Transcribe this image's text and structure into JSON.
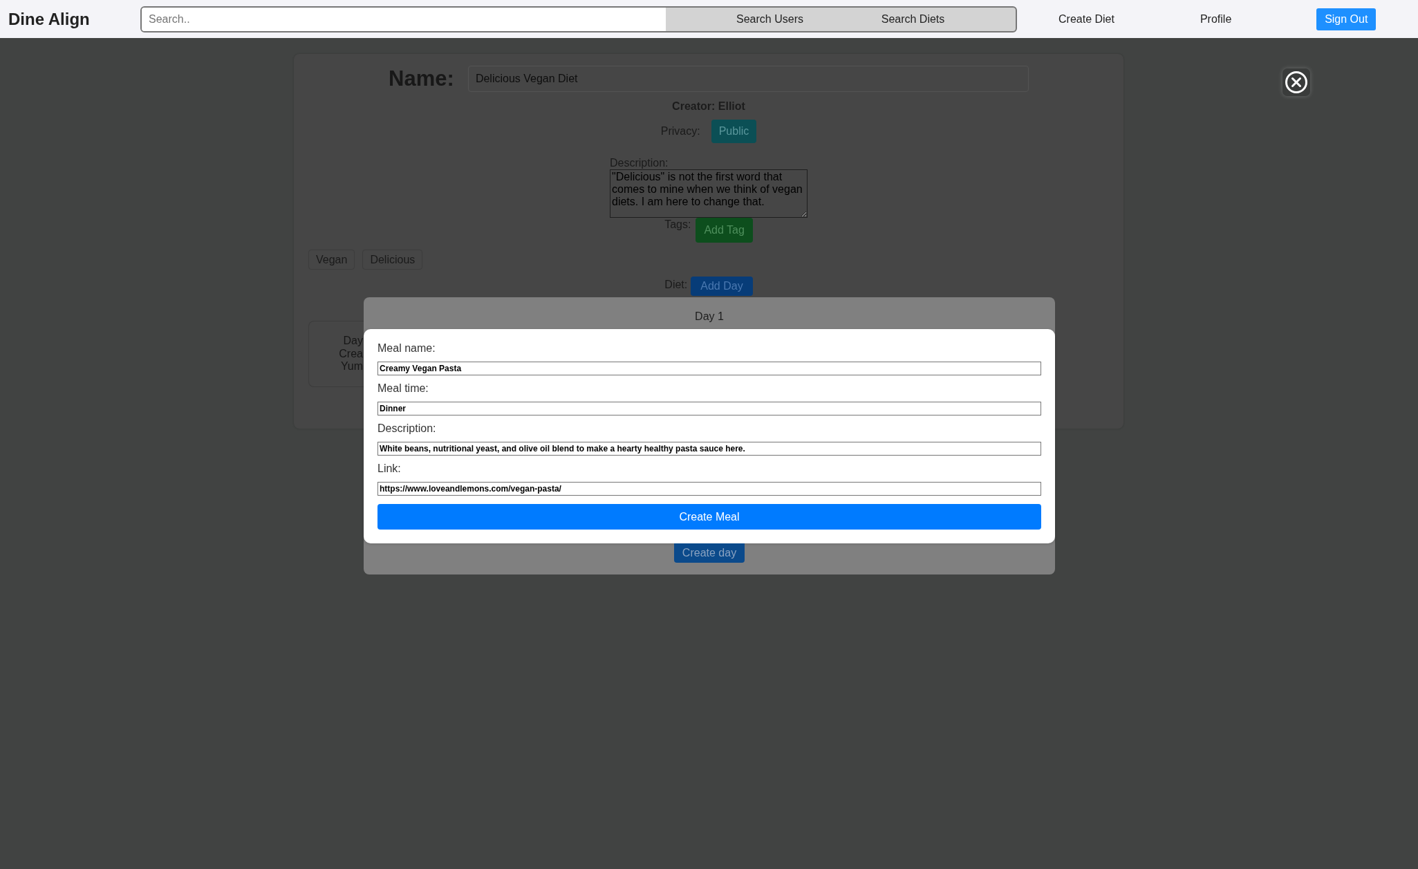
{
  "navbar": {
    "logo": "Dine Align",
    "search": {
      "placeholder": "Search.."
    },
    "search_buttons": [
      "Search Users",
      "Search Diets"
    ],
    "links": [
      "Create Diet",
      "Profile"
    ],
    "sign_out_button": "Sign Out"
  },
  "diet_form": {
    "name_label": "Name:",
    "name_value": "Delicious Vegan Diet",
    "creator": "Creator: Elliot",
    "privacy_label": "Privacy:",
    "privacy_button": "Public",
    "description_label": "Description:",
    "description_value": "\"Delicious\" is not the first word that comes to mine when we think of vegan diets. I am here to change that.",
    "tags_label": "Tags:",
    "add_tag_button": "Add Tag",
    "tags": [
      "Vegan",
      "Delicious"
    ],
    "diet_label": "Diet:",
    "add_day_button": "Add Day",
    "day_cards": [
      {
        "lines": [
          "Day",
          "Crea",
          "Yum"
        ]
      }
    ]
  },
  "day_modal": {
    "title": "Day 1",
    "meal_form": {
      "fields": [
        {
          "label": "Meal name:",
          "value": "Creamy Vegan Pasta"
        },
        {
          "label": "Meal time:",
          "value": "Dinner"
        },
        {
          "label": "Description:",
          "value": "White beans, nutritional yeast, and olive oil blend to make a hearty healthy pasta sauce here."
        },
        {
          "label": "Link:",
          "value": "https://www.loveandlemons.com/vegan-pasta/"
        }
      ],
      "submit_button": "Create Meal"
    },
    "create_day_button": "Create day"
  }
}
